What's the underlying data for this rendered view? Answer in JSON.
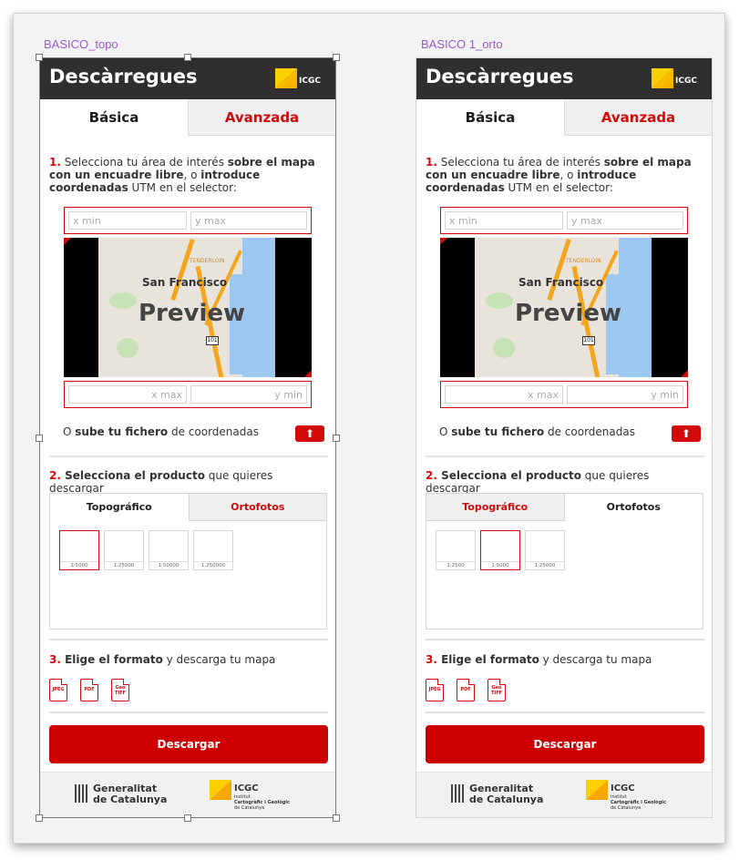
{
  "frames": [
    {
      "label": "BASICO_topo",
      "title": "Descàrregues",
      "logo_text": "ICGC",
      "tabs": [
        "Básica",
        "Avanzada"
      ],
      "step1": {
        "num": "1.",
        "t1": " Selecciona tu área de interés ",
        "b1": "sobre el mapa con un encuadre libre",
        "t2": ", o ",
        "b2": "introduce coordenadas",
        "t3": " UTM en el selector:"
      },
      "coords": {
        "xmin": "x min",
        "ymax": "y max",
        "xmax": "x max",
        "ymin": "y min"
      },
      "map": {
        "place": "San Francisco",
        "district": "TENDERLOIN",
        "overlay": "Preview",
        "shield": "101"
      },
      "upload": {
        "t1": "O ",
        "b1": "sube tu fichero",
        "t2": " de coordenadas"
      },
      "step2": {
        "num": "2.",
        "b1": " Selecciona el producto",
        "t1": " que quieres descargar"
      },
      "product_tabs": [
        "Topográfico",
        "Ortofotos"
      ],
      "product_active": 0,
      "scales": [
        "1:5000",
        "1:25000",
        "1:50000",
        "1:250000"
      ],
      "scale_selected": 0,
      "step3": {
        "num": "3.",
        "b1": " Elige el formato",
        "t1": " y descarga tu mapa"
      },
      "formats": [
        "JPEG",
        "PDF",
        "Geo TIFF"
      ],
      "download": "Descargar",
      "footer": {
        "gen1": "Generalitat",
        "gen2": "de Catalunya",
        "icgc": "ICGC",
        "icgc_sub1": "Institut",
        "icgc_sub2": "Cartogràfic i Geològic",
        "icgc_sub3": "de Catalunya"
      }
    },
    {
      "label": "BASICO 1_orto",
      "title": "Descàrregues",
      "logo_text": "ICGC",
      "tabs": [
        "Básica",
        "Avanzada"
      ],
      "step1": {
        "num": "1.",
        "t1": " Selecciona tu área de interés ",
        "b1": "sobre el mapa con un encuadre libre",
        "t2": ", o ",
        "b2": "introduce coordenadas",
        "t3": " UTM en el selector:"
      },
      "coords": {
        "xmin": "x min",
        "ymax": "y max",
        "xmax": "x max",
        "ymin": "y min"
      },
      "map": {
        "place": "San Francisco",
        "district": "TENDERLOIN",
        "overlay": "Preview",
        "shield": "101"
      },
      "upload": {
        "t1": "O ",
        "b1": "sube tu fichero",
        "t2": " de coordenadas"
      },
      "step2": {
        "num": "2.",
        "b1": " Selecciona el producto",
        "t1": " que quieres descargar"
      },
      "product_tabs": [
        "Topográfico",
        "Ortofotos"
      ],
      "product_active": 1,
      "scales": [
        "1:2500",
        "1:5000",
        "1:25000"
      ],
      "scale_selected": 1,
      "step3": {
        "num": "3.",
        "b1": " Elige el formato",
        "t1": " y descarga tu mapa"
      },
      "formats": [
        "JPEG",
        "PDF",
        "Geo TIFF"
      ],
      "download": "Descargar",
      "footer": {
        "gen1": "Generalitat",
        "gen2": "de Catalunya",
        "icgc": "ICGC",
        "icgc_sub1": "Institut",
        "icgc_sub2": "Cartogràfic i Geològic",
        "icgc_sub3": "de Catalunya"
      }
    }
  ],
  "colors": {
    "brand_red": "#d10a0a",
    "header_dark": "#2f2f2f",
    "label_purple": "#9b5ac9",
    "icgc_yellow": "#fbd000"
  }
}
